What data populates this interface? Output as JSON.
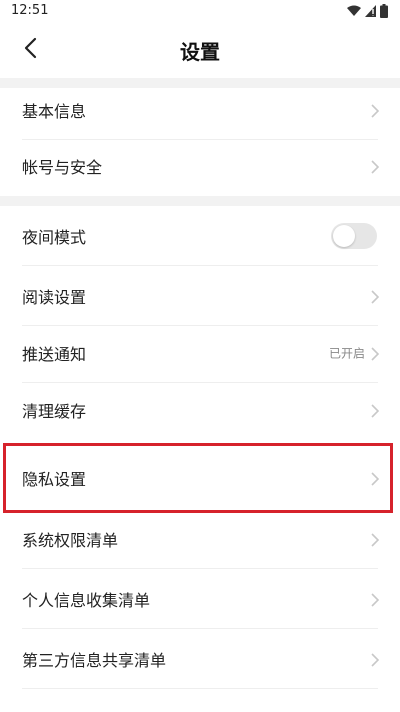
{
  "status_bar": {
    "time": "12:51",
    "icons": [
      "wifi-icon",
      "signal-icon",
      "battery-icon"
    ]
  },
  "header": {
    "back_icon": "chevron-left-icon",
    "title": "设置"
  },
  "sections": [
    {
      "items": [
        {
          "label": "基本信息",
          "type": "link"
        },
        {
          "label": "帐号与安全",
          "type": "link"
        }
      ]
    },
    {
      "items": [
        {
          "label": "夜间模式",
          "type": "toggle",
          "toggle_on": false
        },
        {
          "label": "阅读设置",
          "type": "link"
        },
        {
          "label": "推送通知",
          "type": "link",
          "value": "已开启"
        },
        {
          "label": "清理缓存",
          "type": "link"
        },
        {
          "label": "隐私设置",
          "type": "link",
          "highlighted": true
        },
        {
          "label": "系统权限清单",
          "type": "link"
        },
        {
          "label": "个人信息收集清单",
          "type": "link"
        },
        {
          "label": "第三方信息共享清单",
          "type": "link"
        }
      ]
    }
  ],
  "colors": {
    "highlight": "#d6222b",
    "section_gap": "#f2f2f2",
    "chevron": "#c8c8c8",
    "toggle_off": "#e6e6e6"
  }
}
